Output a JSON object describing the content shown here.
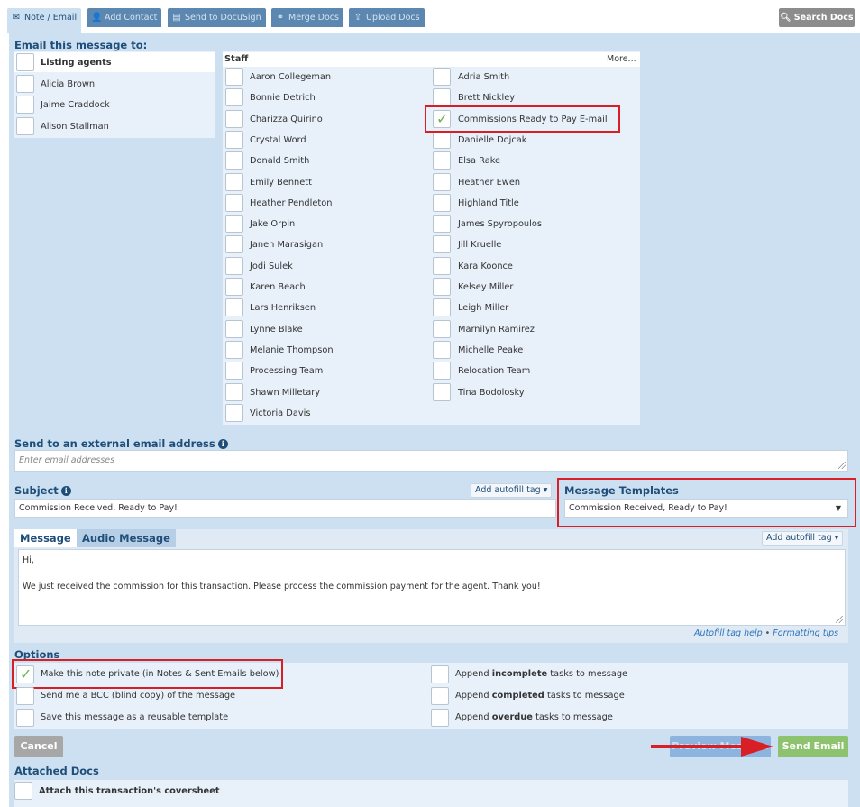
{
  "tabs": [
    {
      "label": "Note / Email",
      "icon": "envelope-icon"
    },
    {
      "label": "Add Contact",
      "icon": "add-user-icon"
    },
    {
      "label": "Send to DocuSign",
      "icon": "docusign-icon"
    },
    {
      "label": "Merge Docs",
      "icon": "merge-icon"
    },
    {
      "label": "Upload Docs",
      "icon": "upload-icon"
    }
  ],
  "search_docs": "Search Docs",
  "email_to": {
    "title": "Email this message to:",
    "agents": [
      "Listing agents",
      "Alicia Brown",
      "Jaime Craddock",
      "Alison Stallman"
    ],
    "staff_title": "Staff",
    "more": "More...",
    "staff_left": [
      "Aaron Collegeman",
      "Bonnie Detrich",
      "Charizza Quirino",
      "Crystal Word",
      "Donald Smith",
      "Emily Bennett",
      "Heather Pendleton",
      "Jake Orpin",
      "Janen Marasigan",
      "Jodi Sulek",
      "Karen Beach",
      "Lars Henriksen",
      "Lynne Blake",
      "Melanie Thompson",
      "Processing Team",
      "Shawn Milletary",
      "Victoria Davis"
    ],
    "staff_right": [
      "Adria Smith",
      "Brett Nickley",
      "Commissions Ready to Pay E-mail",
      "Danielle Dojcak",
      "Elsa Rake",
      "Heather Ewen",
      "Highland Title",
      "James Spyropoulos",
      "Jill Kruelle",
      "Kara Koonce",
      "Kelsey Miller",
      "Leigh Miller",
      "Marnilyn Ramirez",
      "Michelle Peake",
      "Relocation Team",
      "Tina Bodolosky"
    ],
    "checked_right_index": 2
  },
  "external": {
    "title": "Send to an external email address",
    "placeholder": "Enter email addresses"
  },
  "subject": {
    "title": "Subject",
    "value": "Commission Received, Ready to Pay!",
    "autofill": "Add autofill tag ▾"
  },
  "templates": {
    "title": "Message Templates",
    "value": "Commission Received, Ready to Pay!"
  },
  "message": {
    "tab_message": "Message",
    "tab_audio": "Audio Message",
    "autofill": "Add autofill tag ▾",
    "line1": "Hi,",
    "line2": "We just received the commission for this transaction. Please process the commission payment for the agent. Thank you!",
    "help_link": "Autofill tag help",
    "sep": "•",
    "formatting_link": "Formatting tips"
  },
  "options": {
    "title": "Options",
    "private": "Make this note private (in Notes & Sent Emails below)",
    "bcc": "Send me a BCC (blind copy) of the message",
    "save_template": "Save this message as a reusable template",
    "append_incomplete_pre": "Append ",
    "append_incomplete_bold": "incomplete",
    "append_incomplete_post": " tasks to message",
    "append_completed_pre": "Append ",
    "append_completed_bold": "completed",
    "append_completed_post": " tasks to message",
    "append_overdue_pre": "Append ",
    "append_overdue_bold": "overdue",
    "append_overdue_post": " tasks to message"
  },
  "buttons": {
    "cancel": "Cancel",
    "preview": "Preview Message",
    "send": "Send Email"
  },
  "attached": {
    "title": "Attached Docs",
    "coversheet": "Attach this transaction's coversheet"
  },
  "colors": {
    "panel": "#cde0f1",
    "title": "#1f4e79",
    "highlight_red": "#d81f26",
    "send_green": "#8dc26f",
    "check_green": "#6bb34a"
  }
}
